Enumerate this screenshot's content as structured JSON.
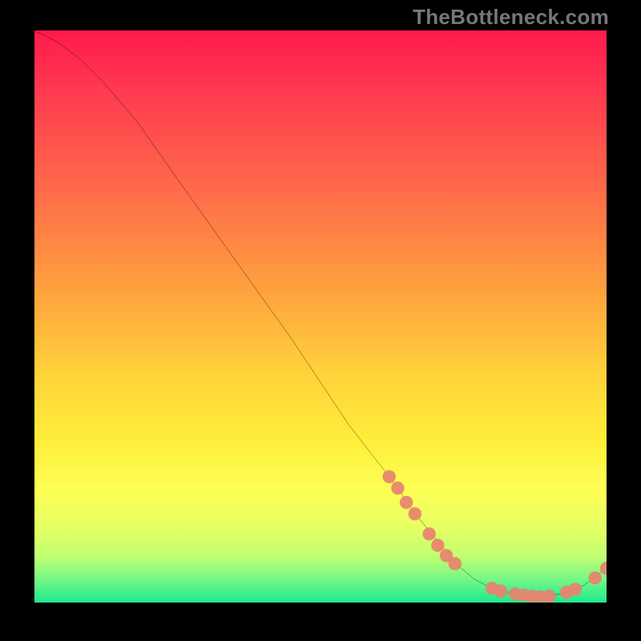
{
  "watermark": "TheBottleneck.com",
  "chart_data": {
    "type": "line",
    "title": "",
    "xlabel": "",
    "ylabel": "",
    "xlim": [
      0,
      100
    ],
    "ylim": [
      0,
      100
    ],
    "grid": false,
    "legend": false,
    "background_gradient_stops": [
      {
        "pos": 0,
        "color": "#ff1a4d"
      },
      {
        "pos": 10,
        "color": "#ff3850"
      },
      {
        "pos": 28,
        "color": "#ff6b4a"
      },
      {
        "pos": 45,
        "color": "#ffa03e"
      },
      {
        "pos": 60,
        "color": "#ffd23a"
      },
      {
        "pos": 72,
        "color": "#ffee3a"
      },
      {
        "pos": 80,
        "color": "#feff55"
      },
      {
        "pos": 87,
        "color": "#e6ff63"
      },
      {
        "pos": 92,
        "color": "#bfff72"
      },
      {
        "pos": 96,
        "color": "#74f786"
      },
      {
        "pos": 100,
        "color": "#1de98e"
      }
    ],
    "series": [
      {
        "name": "bottleneck-curve",
        "stroke": "#000000",
        "stroke_width": 2,
        "x": [
          0,
          4,
          8,
          12,
          18,
          25,
          35,
          45,
          55,
          62,
          67,
          71,
          74,
          77,
          80,
          84,
          88,
          92,
          96,
          100
        ],
        "y": [
          100,
          98,
          95,
          91,
          84,
          74,
          60,
          46,
          31,
          22,
          15,
          10,
          6.5,
          4,
          2.5,
          1.5,
          1,
          1.5,
          3,
          6
        ]
      }
    ],
    "highlight_points": {
      "name": "highlight-dots",
      "color": "#e9826e",
      "radius": 8,
      "points": [
        {
          "x": 62,
          "y": 22
        },
        {
          "x": 63.5,
          "y": 20
        },
        {
          "x": 65,
          "y": 17.5
        },
        {
          "x": 66.5,
          "y": 15.5
        },
        {
          "x": 69,
          "y": 12
        },
        {
          "x": 70.5,
          "y": 10
        },
        {
          "x": 72,
          "y": 8.2
        },
        {
          "x": 73.5,
          "y": 6.8
        },
        {
          "x": 80,
          "y": 2.5
        },
        {
          "x": 81.5,
          "y": 2.0
        },
        {
          "x": 84,
          "y": 1.5
        },
        {
          "x": 85.5,
          "y": 1.3
        },
        {
          "x": 87,
          "y": 1.1
        },
        {
          "x": 88.5,
          "y": 1.0
        },
        {
          "x": 90,
          "y": 1.1
        },
        {
          "x": 93,
          "y": 1.8
        },
        {
          "x": 94.5,
          "y": 2.3
        },
        {
          "x": 98,
          "y": 4.3
        },
        {
          "x": 100,
          "y": 6.0
        }
      ]
    }
  }
}
